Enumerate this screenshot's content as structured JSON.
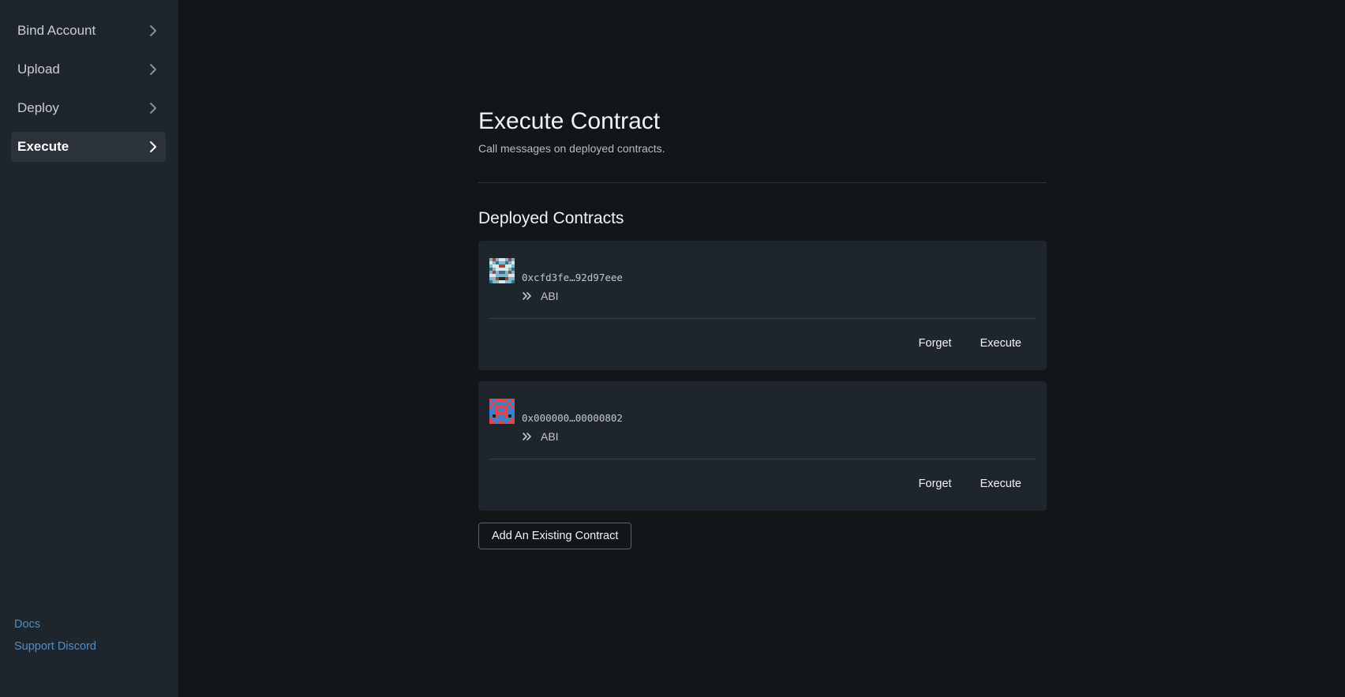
{
  "sidebar": {
    "items": [
      {
        "label": "Bind Account",
        "icon": "chevron-right-icon",
        "active": false
      },
      {
        "label": "Upload",
        "icon": "chevron-right-icon",
        "active": false
      },
      {
        "label": "Deploy",
        "icon": "chevron-right-icon",
        "active": false
      },
      {
        "label": "Execute",
        "icon": "chevron-right-icon",
        "active": true
      }
    ],
    "links": {
      "docs": "Docs",
      "support": "Support Discord"
    }
  },
  "main": {
    "title": "Execute Contract",
    "subtitle": "Call messages on deployed contracts.",
    "section_title": "Deployed Contracts",
    "contracts": [
      {
        "address": "0xcfd3fe…92d97eee",
        "abi_label": "ABI",
        "forget_label": "Forget",
        "execute_label": "Execute",
        "identicon": "identicon-teal"
      },
      {
        "address": "0x000000…00000802",
        "abi_label": "ABI",
        "forget_label": "Forget",
        "execute_label": "Execute",
        "identicon": "identicon-red-blue"
      }
    ],
    "add_button_label": "Add An Existing Contract"
  },
  "colors": {
    "background": "#121619",
    "sidebar": "#1f252c",
    "card": "#1f252c",
    "link": "#4d8fc9",
    "active_item": "#2b323a"
  }
}
